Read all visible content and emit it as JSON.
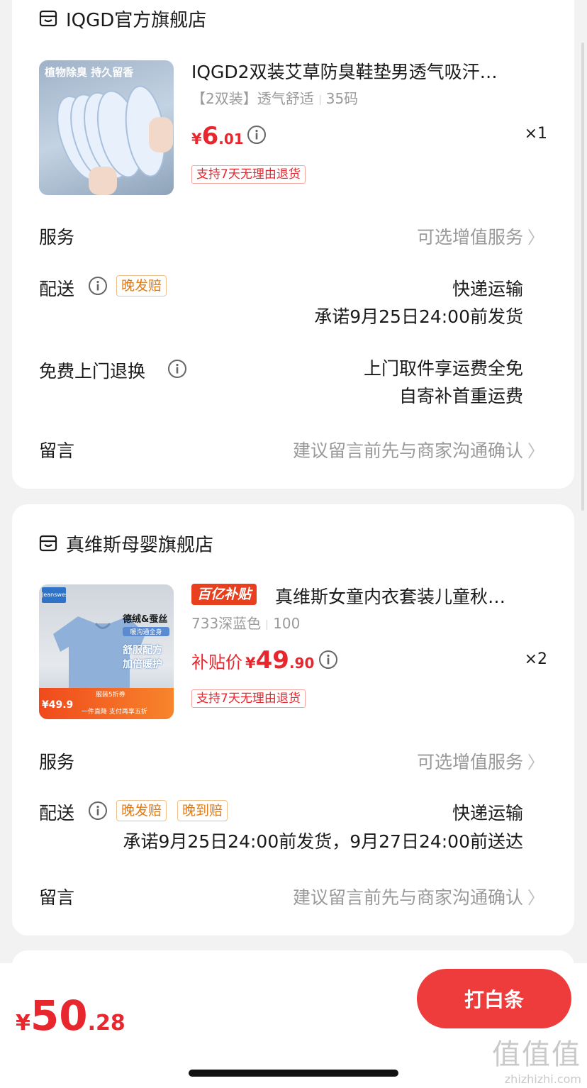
{
  "orders": [
    {
      "store_name": "IQGD官方旗舰店",
      "product": {
        "image_caption": "植物除臭 持久留香",
        "name": "IQGD2双装艾草防臭鞋垫男透气吸汗…",
        "sku_variant": "【2双装】透气舒适",
        "sku_size": "35码",
        "price_yen": "¥",
        "price_int": "6",
        "price_dec": ".01",
        "qty": "×1",
        "return_tag": "支持7天无理由退货"
      },
      "service_label": "服务",
      "service_value": "可选增值服务",
      "delivery_label": "配送",
      "delivery_tags": [
        "晚发赔"
      ],
      "delivery_method": "快递运输",
      "delivery_promise": "承诺9月25日24:00前发货",
      "return_label": "免费上门退换",
      "return_line1": "上门取件享运费全免",
      "return_line2": "自寄补首重运费",
      "message_label": "留言",
      "message_placeholder": "建议留言前先与商家沟通确认"
    },
    {
      "store_name": "真维斯母婴旗舰店",
      "product": {
        "subsidy_badge": "百亿补贴",
        "name": "真维斯女童内衣套装儿童秋…",
        "sku_variant": "733深蓝色",
        "sku_size": "100",
        "price_prefix": "补贴价",
        "price_yen": "¥",
        "price_int": "49",
        "price_dec": ".90",
        "qty": "×2",
        "return_tag": "支持7天无理由退货",
        "image_texts": {
          "brand": "Jeanswest",
          "headline": "德绒&蚕丝",
          "sub": "暖沟通全身",
          "line1": "舒服配方",
          "line2": "加倍暖护",
          "promo_price": "¥49.9",
          "promo_discount": "服装5折券",
          "promo_bar": "一件直降 支付再享五折"
        }
      },
      "service_label": "服务",
      "service_value": "可选增值服务",
      "delivery_label": "配送",
      "delivery_tags": [
        "晚发赔",
        "晚到赔"
      ],
      "delivery_method": "快递运输",
      "delivery_promise": "承诺9月25日24:00前发货，9月27日24:00前送达",
      "message_label": "留言",
      "message_placeholder": "建议留言前先与商家沟通确认"
    }
  ],
  "footer": {
    "total_yen": "¥",
    "total_int": "50",
    "total_dec": ".28",
    "pay_button": "打白条",
    "watermark_logo": "值值值",
    "watermark_url": "zhizhizhi.com"
  },
  "colors": {
    "accent_red": "#e8262e",
    "orange_tag": "#e27a12",
    "page_bg": "#f2f2f2"
  },
  "icons": {
    "store": "store-icon",
    "info": "info-icon",
    "chevron": "chevron-right-icon"
  }
}
